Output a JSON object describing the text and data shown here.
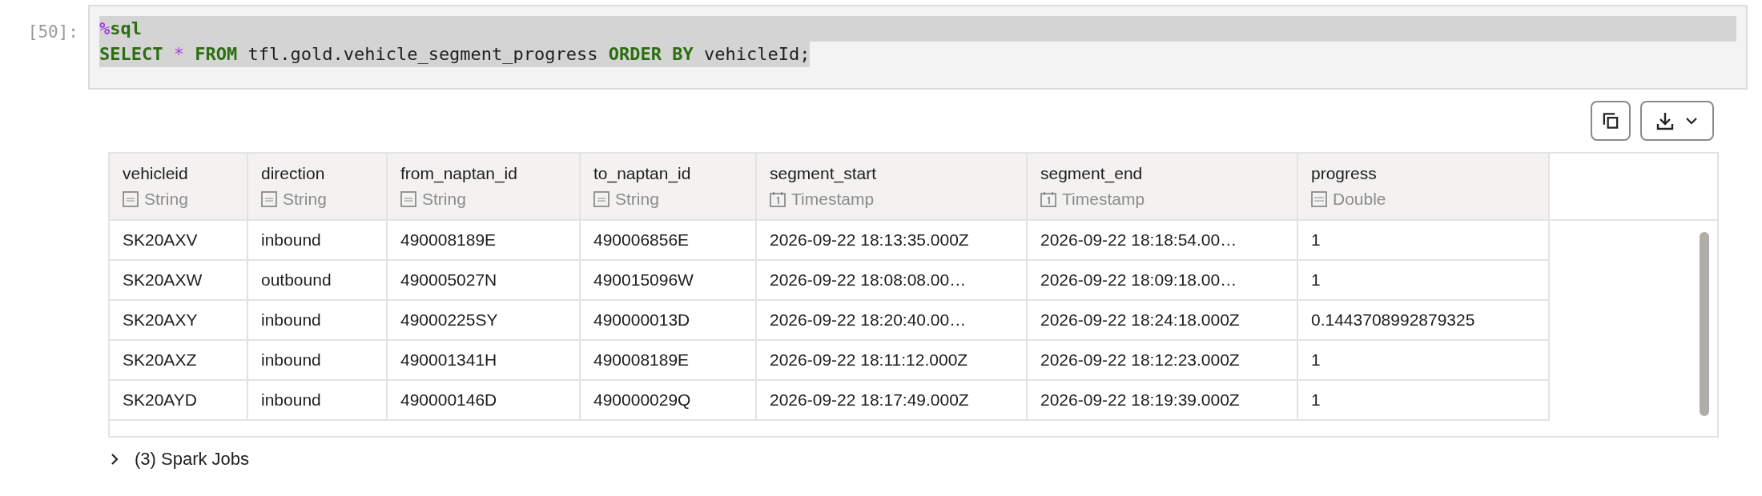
{
  "cell": {
    "prompt": "[50]:",
    "lines": [
      {
        "full": true,
        "tokens": [
          {
            "kind": "magic",
            "text": "%"
          },
          {
            "kind": "keyword",
            "text": "sql"
          }
        ]
      },
      {
        "full": false,
        "tokens": [
          {
            "kind": "keyword",
            "text": "SELECT"
          },
          {
            "kind": "op",
            "text": " * "
          },
          {
            "kind": "keyword",
            "text": "FROM"
          },
          {
            "kind": "plain",
            "text": " tfl.gold.vehicle_segment_progress "
          },
          {
            "kind": "keyword",
            "text": "ORDER BY"
          },
          {
            "kind": "plain",
            "text": " vehicleId;"
          }
        ]
      }
    ]
  },
  "toolbar": [
    {
      "kind": "copy"
    },
    {
      "kind": "download"
    }
  ],
  "table": {
    "columns": [
      {
        "name": "vehicleid",
        "type": "String",
        "kind": "string"
      },
      {
        "name": "direction",
        "type": "String",
        "kind": "string"
      },
      {
        "name": "from_naptan_id",
        "type": "String",
        "kind": "string"
      },
      {
        "name": "to_naptan_id",
        "type": "String",
        "kind": "string"
      },
      {
        "name": "segment_start",
        "type": "Timestamp",
        "kind": "timestamp"
      },
      {
        "name": "segment_end",
        "type": "Timestamp",
        "kind": "timestamp"
      },
      {
        "name": "progress",
        "type": "Double",
        "kind": "double"
      }
    ],
    "rows": [
      [
        "SK20AXV",
        "inbound",
        "490008189E",
        "490006856E",
        "2026-09-22 18:13:35.000Z",
        "2026-09-22 18:18:54.00…",
        "1"
      ],
      [
        "SK20AXW",
        "outbound",
        "490005027N",
        "490015096W",
        "2026-09-22 18:08:08.00…",
        "2026-09-22 18:09:18.00…",
        "1"
      ],
      [
        "SK20AXY",
        "inbound",
        "49000225SY",
        "490000013D",
        "2026-09-22 18:20:40.00…",
        "2026-09-22 18:24:18.000Z",
        "0.1443708992879325"
      ],
      [
        "SK20AXZ",
        "inbound",
        "490001341H",
        "490008189E",
        "2026-09-22 18:11:12.000Z",
        "2026-09-22 18:12:23.000Z",
        "1"
      ],
      [
        "SK20AYD",
        "inbound",
        "490000146D",
        "490000029Q",
        "2026-09-22 18:17:49.000Z",
        "2026-09-22 18:19:39.000Z",
        "1"
      ]
    ]
  },
  "jobs": {
    "label": "(3) Spark Jobs",
    "expanded": false
  }
}
